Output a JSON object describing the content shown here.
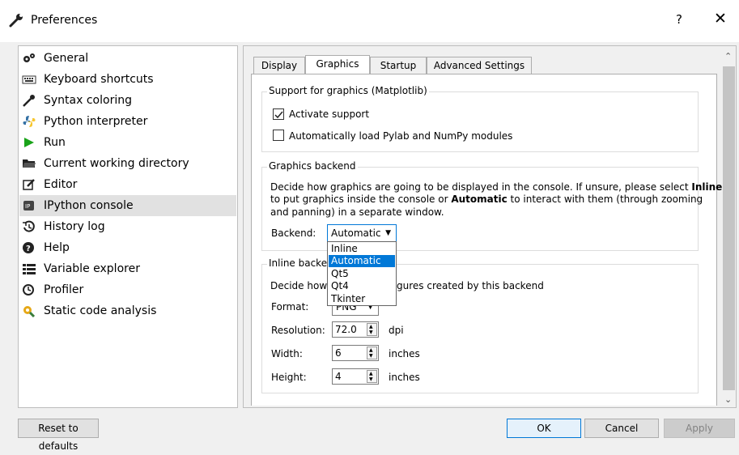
{
  "window": {
    "title": "Preferences",
    "help": "?",
    "close": "✕"
  },
  "sidebar": {
    "items": [
      {
        "label": "General",
        "icon": "gears-icon"
      },
      {
        "label": "Keyboard shortcuts",
        "icon": "keyboard-icon"
      },
      {
        "label": "Syntax coloring",
        "icon": "eyedropper-icon"
      },
      {
        "label": "Python interpreter",
        "icon": "python-icon"
      },
      {
        "label": "Run",
        "icon": "play-icon"
      },
      {
        "label": "Current working directory",
        "icon": "folder-icon"
      },
      {
        "label": "Editor",
        "icon": "edit-icon"
      },
      {
        "label": "IPython console",
        "icon": "ipython-icon",
        "selected": true
      },
      {
        "label": "History log",
        "icon": "history-icon"
      },
      {
        "label": "Help",
        "icon": "help-icon"
      },
      {
        "label": "Variable explorer",
        "icon": "list-icon"
      },
      {
        "label": "Profiler",
        "icon": "clock-icon"
      },
      {
        "label": "Static code analysis",
        "icon": "analysis-icon"
      }
    ]
  },
  "tabs": [
    {
      "label": "Display"
    },
    {
      "label": "Graphics",
      "active": true
    },
    {
      "label": "Startup"
    },
    {
      "label": "Advanced Settings"
    }
  ],
  "support_group": {
    "title": "Support for graphics (Matplotlib)",
    "activate_label": "Activate support",
    "activate_checked": true,
    "autoload_label": "Automatically load Pylab and NumPy modules",
    "autoload_checked": false
  },
  "backend_group": {
    "title": "Graphics backend",
    "desc_line1_a": "Decide how graphics are going to be displayed in the console. If unsure, please select ",
    "desc_line1_b": "Inline",
    "desc_line2_a": "to put graphics inside the console or ",
    "desc_line2_b": "Automatic",
    "desc_line2_c": " to interact with them (through zooming",
    "desc_line3": "and panning) in a separate window.",
    "backend_label": "Backend:",
    "backend_value": "Automatic",
    "options": [
      "Inline",
      "Automatic",
      "Qt5",
      "Qt4",
      "Tkinter"
    ],
    "highlighted_option": "Automatic"
  },
  "inline_group": {
    "title_visible": "Inline backen",
    "desc_visible_a": "Decide how ",
    "desc_visible_b": "gures created by this backend",
    "format_label": "Format:",
    "format_value": "PNG",
    "resolution_label": "Resolution:",
    "resolution_value": "72.0",
    "resolution_unit": "dpi",
    "width_label": "Width:",
    "width_value": "6",
    "width_unit": "inches",
    "height_label": "Height:",
    "height_value": "4",
    "height_unit": "inches"
  },
  "buttons": {
    "reset": "Reset to defaults",
    "ok": "OK",
    "cancel": "Cancel",
    "apply": "Apply"
  },
  "colors": {
    "accent": "#0078d7",
    "selected_item": "#e1e1e1"
  }
}
